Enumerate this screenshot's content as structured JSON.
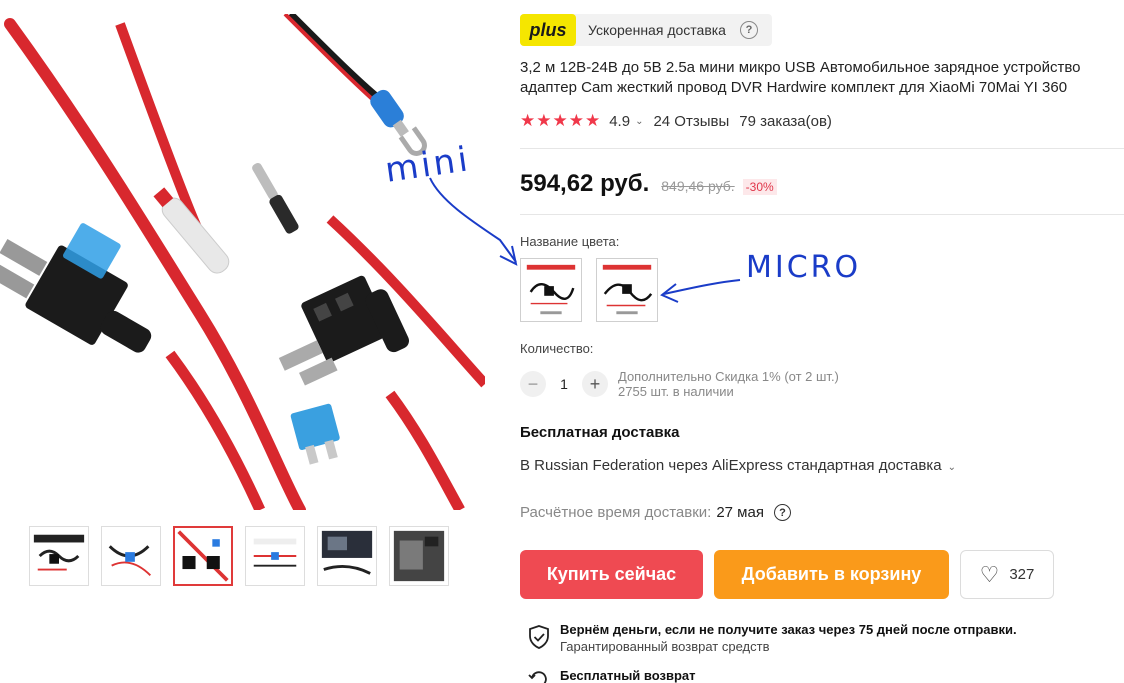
{
  "gallery": {
    "thumb_count": 6,
    "active_thumb": 2
  },
  "plus": {
    "badge": "plus",
    "text": "Ускоренная доставка",
    "help": "?"
  },
  "product": {
    "title": "3,2 м 12В-24В до 5В 2.5a мини микро USB Автомобильное зарядное устройство адаптер Cam жесткий провод DVR Hardwire комплект для XiaoMi 70Mai YI 360",
    "stars": "★★★★★",
    "rating": "4.9",
    "reviews": "24 Отзывы",
    "orders": "79 заказа(ов)"
  },
  "price": {
    "current": "594,62 руб.",
    "old": "849,46 руб.",
    "discount": "-30%"
  },
  "color": {
    "label": "Название цвета:",
    "options": [
      "mini",
      "micro"
    ]
  },
  "quantity": {
    "label": "Количество:",
    "minus": "−",
    "value": "1",
    "plus": "+",
    "note_discount": "Дополнительно Скидка 1% (от 2 шт.)",
    "note_stock": "2755 шт. в наличии"
  },
  "shipping": {
    "title": "Бесплатная доставка",
    "method": "В Russian Federation через AliExpress стандартная доставка",
    "eta_label": "Расчётное время доставки:",
    "eta_date": "27 мая",
    "help": "?"
  },
  "actions": {
    "buy": "Купить сейчас",
    "cart": "Добавить в корзину",
    "wish_count": "327"
  },
  "guarantee": {
    "title": "Вернём деньги, если не получите заказ через 75 дней после отправки.",
    "subtitle": "Гарантированный возврат средств"
  },
  "returns": {
    "title": "Бесплатный возврат"
  },
  "annotations": {
    "mini": "mini",
    "micro": "MICRO"
  },
  "colors": {
    "accent_red": "#ef4a52",
    "accent_orange": "#fa9a1a",
    "plus_yellow": "#f5e600",
    "annotation_blue": "#1a3cc8"
  }
}
